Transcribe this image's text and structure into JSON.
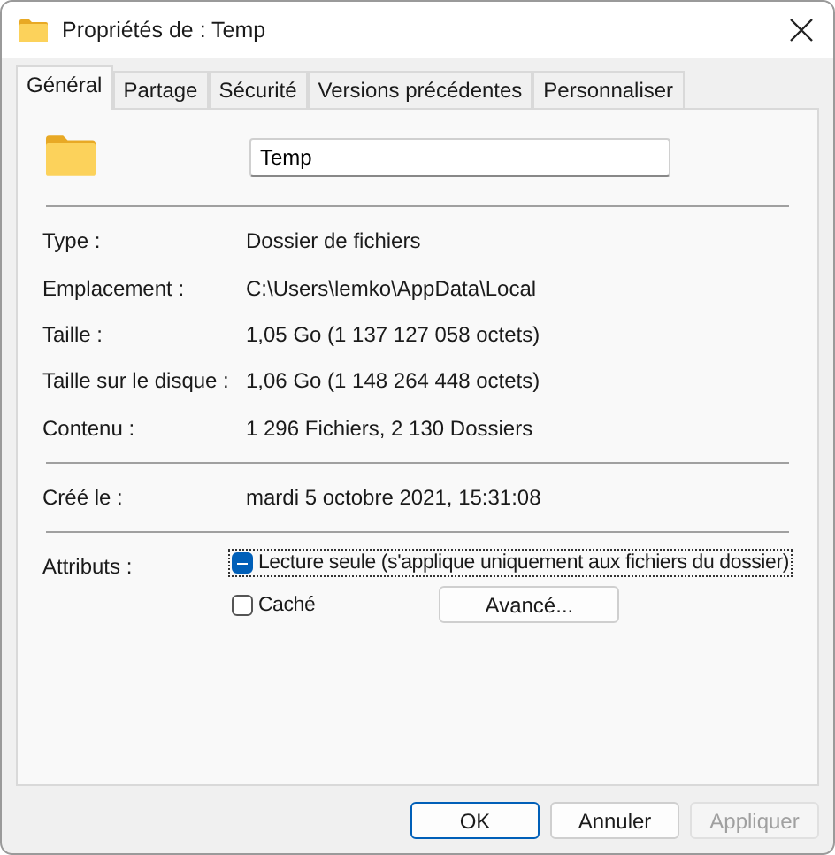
{
  "window": {
    "title": "Propriétés de : Temp"
  },
  "tabs": [
    {
      "label": "Général",
      "selected": true
    },
    {
      "label": "Partage",
      "selected": false
    },
    {
      "label": "Sécurité",
      "selected": false
    },
    {
      "label": "Versions précédentes",
      "selected": false
    },
    {
      "label": "Personnaliser",
      "selected": false
    }
  ],
  "name_field": {
    "value": "Temp"
  },
  "groups": [
    [
      {
        "label": "Type :",
        "value": "Dossier de fichiers"
      },
      {
        "label": "Emplacement :",
        "value": "C:\\Users\\lemko\\AppData\\Local"
      },
      {
        "label": "Taille :",
        "value": "1,05 Go (1 137 127 058 octets)"
      },
      {
        "label": "Taille sur le disque :",
        "value": "1,06 Go (1 148 264 448 octets)"
      },
      {
        "label": "Contenu :",
        "value": "1 296 Fichiers, 2 130 Dossiers"
      }
    ],
    [
      {
        "label": "Créé le :",
        "value": "mardi 5 octobre 2021, 15:31:08"
      }
    ]
  ],
  "attributes": {
    "label": "Attributs :",
    "checkboxes": [
      {
        "label": "Lecture seule (s'applique uniquement aux fichiers du dossier)",
        "checked": true,
        "indeterminate": true,
        "focused": true
      },
      {
        "label": "Caché",
        "checked": false,
        "indeterminate": false,
        "focused": false
      }
    ],
    "advanced_button": "Avancé..."
  },
  "buttons": [
    {
      "label": "OK",
      "default": true,
      "disabled": false
    },
    {
      "label": "Annuler",
      "default": false,
      "disabled": false
    },
    {
      "label": "Appliquer",
      "default": false,
      "disabled": true
    }
  ]
}
